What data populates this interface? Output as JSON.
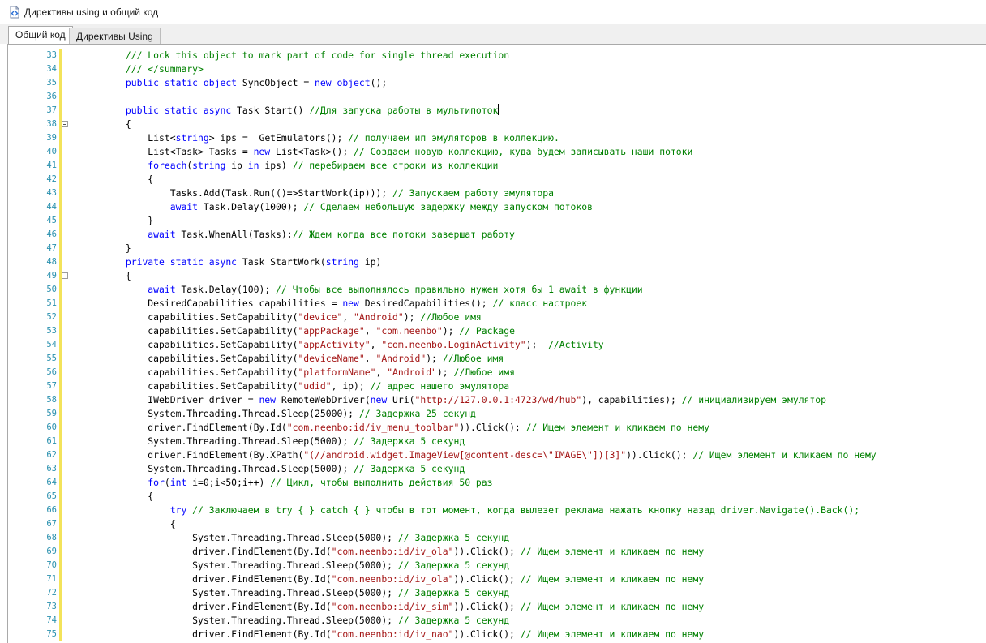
{
  "window": {
    "title": "Директивы using и общий код",
    "icon": "csharp-file-icon"
  },
  "tabs": [
    {
      "label": "Общий код",
      "active": true
    },
    {
      "label": "Директивы Using",
      "active": false
    }
  ],
  "colors": {
    "keyword": "#0000ff",
    "comment": "#008000",
    "string": "#a31515",
    "line_number": "#2b91af",
    "change_marker": "#f3e35a"
  },
  "editor": {
    "caret_line": 37,
    "lines": [
      {
        "n": "33",
        "fold": false,
        "tokens": [
          {
            "t": "cm",
            "v": "        /// Lock this object to mark part of code for single thread execution"
          }
        ]
      },
      {
        "n": "34",
        "fold": false,
        "tokens": [
          {
            "t": "cm",
            "v": "        /// </summary>"
          }
        ]
      },
      {
        "n": "35",
        "fold": false,
        "tokens": [
          {
            "t": "pl",
            "v": "        "
          },
          {
            "t": "kw",
            "v": "public static object"
          },
          {
            "t": "pl",
            "v": " SyncObject = "
          },
          {
            "t": "kw",
            "v": "new object"
          },
          {
            "t": "pl",
            "v": "();"
          }
        ]
      },
      {
        "n": "36",
        "fold": false,
        "tokens": []
      },
      {
        "n": "37",
        "fold": false,
        "tokens": [
          {
            "t": "pl",
            "v": "        "
          },
          {
            "t": "kw",
            "v": "public static async"
          },
          {
            "t": "pl",
            "v": " Task Start() "
          },
          {
            "t": "cm",
            "v": "//Для запуска работы в мультипоток"
          }
        ]
      },
      {
        "n": "38",
        "fold": true,
        "tokens": [
          {
            "t": "pl",
            "v": "        {"
          }
        ]
      },
      {
        "n": "39",
        "fold": false,
        "tokens": [
          {
            "t": "pl",
            "v": "            List<"
          },
          {
            "t": "kw",
            "v": "string"
          },
          {
            "t": "pl",
            "v": "> ips =  GetEmulators(); "
          },
          {
            "t": "cm",
            "v": "// получаем ип эмуляторов в коллекцию."
          }
        ]
      },
      {
        "n": "40",
        "fold": false,
        "tokens": [
          {
            "t": "pl",
            "v": "            List<Task> Tasks = "
          },
          {
            "t": "kw",
            "v": "new"
          },
          {
            "t": "pl",
            "v": " List<Task>(); "
          },
          {
            "t": "cm",
            "v": "// Создаем новую коллекцию, куда будем записывать наши потоки"
          }
        ]
      },
      {
        "n": "41",
        "fold": false,
        "tokens": [
          {
            "t": "pl",
            "v": "            "
          },
          {
            "t": "kw",
            "v": "foreach"
          },
          {
            "t": "pl",
            "v": "("
          },
          {
            "t": "kw",
            "v": "string"
          },
          {
            "t": "pl",
            "v": " ip "
          },
          {
            "t": "kw",
            "v": "in"
          },
          {
            "t": "pl",
            "v": " ips) "
          },
          {
            "t": "cm",
            "v": "// перебираем все строки из коллекции"
          }
        ]
      },
      {
        "n": "42",
        "fold": false,
        "tokens": [
          {
            "t": "pl",
            "v": "            {"
          }
        ]
      },
      {
        "n": "43",
        "fold": false,
        "tokens": [
          {
            "t": "pl",
            "v": "                Tasks.Add(Task.Run(()=>StartWork(ip))); "
          },
          {
            "t": "cm",
            "v": "// Запускаем работу эмулятора"
          }
        ]
      },
      {
        "n": "44",
        "fold": false,
        "tokens": [
          {
            "t": "pl",
            "v": "                "
          },
          {
            "t": "kw",
            "v": "await"
          },
          {
            "t": "pl",
            "v": " Task.Delay(1000); "
          },
          {
            "t": "cm",
            "v": "// Сделаем небольшую задержку между запуском потоков"
          }
        ]
      },
      {
        "n": "45",
        "fold": false,
        "tokens": [
          {
            "t": "pl",
            "v": "            }"
          }
        ]
      },
      {
        "n": "46",
        "fold": false,
        "tokens": [
          {
            "t": "pl",
            "v": "            "
          },
          {
            "t": "kw",
            "v": "await"
          },
          {
            "t": "pl",
            "v": " Task.WhenAll(Tasks);"
          },
          {
            "t": "cm",
            "v": "// Ждем когда все потоки завершат работу"
          }
        ]
      },
      {
        "n": "47",
        "fold": false,
        "tokens": [
          {
            "t": "pl",
            "v": "        }"
          }
        ]
      },
      {
        "n": "48",
        "fold": false,
        "tokens": [
          {
            "t": "pl",
            "v": "        "
          },
          {
            "t": "kw",
            "v": "private static async"
          },
          {
            "t": "pl",
            "v": " Task StartWork("
          },
          {
            "t": "kw",
            "v": "string"
          },
          {
            "t": "pl",
            "v": " ip)"
          }
        ]
      },
      {
        "n": "49",
        "fold": true,
        "tokens": [
          {
            "t": "pl",
            "v": "        {"
          }
        ]
      },
      {
        "n": "50",
        "fold": false,
        "tokens": [
          {
            "t": "pl",
            "v": "            "
          },
          {
            "t": "kw",
            "v": "await"
          },
          {
            "t": "pl",
            "v": " Task.Delay(100); "
          },
          {
            "t": "cm",
            "v": "// Чтобы все выполнялось правильно нужен хотя бы 1 await в функции"
          }
        ]
      },
      {
        "n": "51",
        "fold": false,
        "tokens": [
          {
            "t": "pl",
            "v": "            DesiredCapabilities capabilities = "
          },
          {
            "t": "kw",
            "v": "new"
          },
          {
            "t": "pl",
            "v": " DesiredCapabilities(); "
          },
          {
            "t": "cm",
            "v": "// класс настроек"
          }
        ]
      },
      {
        "n": "52",
        "fold": false,
        "tokens": [
          {
            "t": "pl",
            "v": "            capabilities.SetCapability("
          },
          {
            "t": "st",
            "v": "\"device\""
          },
          {
            "t": "pl",
            "v": ", "
          },
          {
            "t": "st",
            "v": "\"Android\""
          },
          {
            "t": "pl",
            "v": "); "
          },
          {
            "t": "cm",
            "v": "//Любое имя"
          }
        ]
      },
      {
        "n": "53",
        "fold": false,
        "tokens": [
          {
            "t": "pl",
            "v": "            capabilities.SetCapability("
          },
          {
            "t": "st",
            "v": "\"appPackage\""
          },
          {
            "t": "pl",
            "v": ", "
          },
          {
            "t": "st",
            "v": "\"com.neenbo\""
          },
          {
            "t": "pl",
            "v": "); "
          },
          {
            "t": "cm",
            "v": "// Package"
          }
        ]
      },
      {
        "n": "54",
        "fold": false,
        "tokens": [
          {
            "t": "pl",
            "v": "            capabilities.SetCapability("
          },
          {
            "t": "st",
            "v": "\"appActivity\""
          },
          {
            "t": "pl",
            "v": ", "
          },
          {
            "t": "st",
            "v": "\"com.neenbo.LoginActivity\""
          },
          {
            "t": "pl",
            "v": ");  "
          },
          {
            "t": "cm",
            "v": "//Activity"
          }
        ]
      },
      {
        "n": "55",
        "fold": false,
        "tokens": [
          {
            "t": "pl",
            "v": "            capabilities.SetCapability("
          },
          {
            "t": "st",
            "v": "\"deviceName\""
          },
          {
            "t": "pl",
            "v": ", "
          },
          {
            "t": "st",
            "v": "\"Android\""
          },
          {
            "t": "pl",
            "v": "); "
          },
          {
            "t": "cm",
            "v": "//Любое имя"
          }
        ]
      },
      {
        "n": "56",
        "fold": false,
        "tokens": [
          {
            "t": "pl",
            "v": "            capabilities.SetCapability("
          },
          {
            "t": "st",
            "v": "\"platformName\""
          },
          {
            "t": "pl",
            "v": ", "
          },
          {
            "t": "st",
            "v": "\"Android\""
          },
          {
            "t": "pl",
            "v": "); "
          },
          {
            "t": "cm",
            "v": "//Любое имя"
          }
        ]
      },
      {
        "n": "57",
        "fold": false,
        "tokens": [
          {
            "t": "pl",
            "v": "            capabilities.SetCapability("
          },
          {
            "t": "st",
            "v": "\"udid\""
          },
          {
            "t": "pl",
            "v": ", ip); "
          },
          {
            "t": "cm",
            "v": "// адрес нашего эмулятора"
          }
        ]
      },
      {
        "n": "58",
        "fold": false,
        "tokens": [
          {
            "t": "pl",
            "v": "            IWebDriver driver = "
          },
          {
            "t": "kw",
            "v": "new"
          },
          {
            "t": "pl",
            "v": " RemoteWebDriver("
          },
          {
            "t": "kw",
            "v": "new"
          },
          {
            "t": "pl",
            "v": " Uri("
          },
          {
            "t": "st",
            "v": "\"http://127.0.0.1:4723/wd/hub\""
          },
          {
            "t": "pl",
            "v": "), capabilities); "
          },
          {
            "t": "cm",
            "v": "// инициализируем эмулятор"
          }
        ]
      },
      {
        "n": "59",
        "fold": false,
        "tokens": [
          {
            "t": "pl",
            "v": "            System.Threading.Thread.Sleep(25000); "
          },
          {
            "t": "cm",
            "v": "// Задержка 25 секунд"
          }
        ]
      },
      {
        "n": "60",
        "fold": false,
        "tokens": [
          {
            "t": "pl",
            "v": "            driver.FindElement(By.Id("
          },
          {
            "t": "st",
            "v": "\"com.neenbo:id/iv_menu_toolbar\""
          },
          {
            "t": "pl",
            "v": ")).Click(); "
          },
          {
            "t": "cm",
            "v": "// Ищем элемент и кликаем по нему"
          }
        ]
      },
      {
        "n": "61",
        "fold": false,
        "tokens": [
          {
            "t": "pl",
            "v": "            System.Threading.Thread.Sleep(5000); "
          },
          {
            "t": "cm",
            "v": "// Задержка 5 секунд"
          }
        ]
      },
      {
        "n": "62",
        "fold": false,
        "tokens": [
          {
            "t": "pl",
            "v": "            driver.FindElement(By.XPath("
          },
          {
            "t": "st",
            "v": "\"(//android.widget.ImageView[@content-desc=\\\"IMAGE\\\"])[3]\""
          },
          {
            "t": "pl",
            "v": ")).Click(); "
          },
          {
            "t": "cm",
            "v": "// Ищем элемент и кликаем по нему"
          }
        ]
      },
      {
        "n": "63",
        "fold": false,
        "tokens": [
          {
            "t": "pl",
            "v": "            System.Threading.Thread.Sleep(5000); "
          },
          {
            "t": "cm",
            "v": "// Задержка 5 секунд"
          }
        ]
      },
      {
        "n": "64",
        "fold": false,
        "tokens": [
          {
            "t": "pl",
            "v": "            "
          },
          {
            "t": "kw",
            "v": "for"
          },
          {
            "t": "pl",
            "v": "("
          },
          {
            "t": "kw",
            "v": "int"
          },
          {
            "t": "pl",
            "v": " i=0;i<50;i++) "
          },
          {
            "t": "cm",
            "v": "// Цикл, чтобы выполнить действия 50 раз"
          }
        ]
      },
      {
        "n": "65",
        "fold": false,
        "tokens": [
          {
            "t": "pl",
            "v": "            {"
          }
        ]
      },
      {
        "n": "66",
        "fold": false,
        "tokens": [
          {
            "t": "pl",
            "v": "                "
          },
          {
            "t": "kw",
            "v": "try"
          },
          {
            "t": "pl",
            "v": " "
          },
          {
            "t": "cm",
            "v": "// Заключаем в try { } catch { } чтобы в тот момент, когда вылезет реклама нажать кнопку назад driver.Navigate().Back();"
          }
        ]
      },
      {
        "n": "67",
        "fold": false,
        "tokens": [
          {
            "t": "pl",
            "v": "                {"
          }
        ]
      },
      {
        "n": "68",
        "fold": false,
        "tokens": [
          {
            "t": "pl",
            "v": "                    System.Threading.Thread.Sleep(5000); "
          },
          {
            "t": "cm",
            "v": "// Задержка 5 секунд"
          }
        ]
      },
      {
        "n": "69",
        "fold": false,
        "tokens": [
          {
            "t": "pl",
            "v": "                    driver.FindElement(By.Id("
          },
          {
            "t": "st",
            "v": "\"com.neenbo:id/iv_ola\""
          },
          {
            "t": "pl",
            "v": ")).Click(); "
          },
          {
            "t": "cm",
            "v": "// Ищем элемент и кликаем по нему"
          }
        ]
      },
      {
        "n": "70",
        "fold": false,
        "tokens": [
          {
            "t": "pl",
            "v": "                    System.Threading.Thread.Sleep(5000); "
          },
          {
            "t": "cm",
            "v": "// Задержка 5 секунд"
          }
        ]
      },
      {
        "n": "71",
        "fold": false,
        "tokens": [
          {
            "t": "pl",
            "v": "                    driver.FindElement(By.Id("
          },
          {
            "t": "st",
            "v": "\"com.neenbo:id/iv_ola\""
          },
          {
            "t": "pl",
            "v": ")).Click(); "
          },
          {
            "t": "cm",
            "v": "// Ищем элемент и кликаем по нему"
          }
        ]
      },
      {
        "n": "72",
        "fold": false,
        "tokens": [
          {
            "t": "pl",
            "v": "                    System.Threading.Thread.Sleep(5000); "
          },
          {
            "t": "cm",
            "v": "// Задержка 5 секунд"
          }
        ]
      },
      {
        "n": "73",
        "fold": false,
        "tokens": [
          {
            "t": "pl",
            "v": "                    driver.FindElement(By.Id("
          },
          {
            "t": "st",
            "v": "\"com.neenbo:id/iv_sim\""
          },
          {
            "t": "pl",
            "v": ")).Click(); "
          },
          {
            "t": "cm",
            "v": "// Ищем элемент и кликаем по нему"
          }
        ]
      },
      {
        "n": "74",
        "fold": false,
        "tokens": [
          {
            "t": "pl",
            "v": "                    System.Threading.Thread.Sleep(5000); "
          },
          {
            "t": "cm",
            "v": "// Задержка 5 секунд"
          }
        ]
      },
      {
        "n": "75",
        "fold": false,
        "tokens": [
          {
            "t": "pl",
            "v": "                    driver.FindElement(By.Id("
          },
          {
            "t": "st",
            "v": "\"com.neenbo:id/iv_nao\""
          },
          {
            "t": "pl",
            "v": ")).Click(); "
          },
          {
            "t": "cm",
            "v": "// Ищем элемент и кликаем по нему"
          }
        ]
      }
    ]
  }
}
